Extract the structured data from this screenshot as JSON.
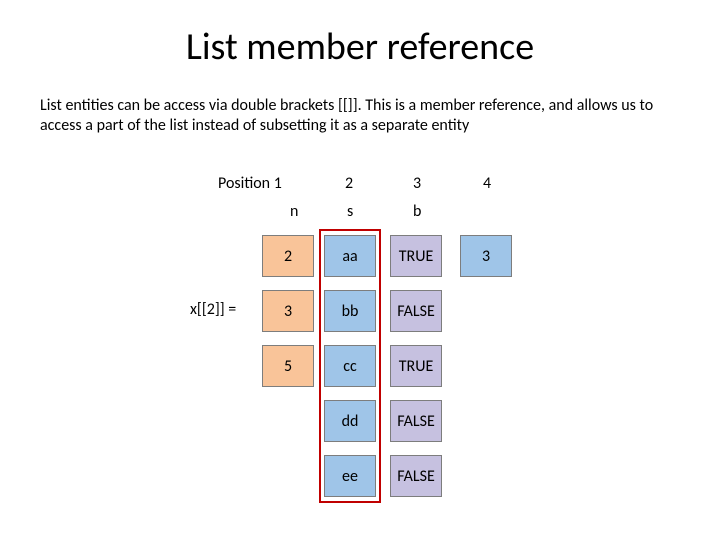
{
  "title": "List member reference",
  "description": "List entities can be access via double brackets [[]]. This is a member reference, and allows us to access a part of the list instead of subsetting it as a separate entity",
  "positions": {
    "p1": "Position 1",
    "p2": "2",
    "p3": "3",
    "p4": "4"
  },
  "headers": {
    "n": "n",
    "s": "s",
    "b": "b"
  },
  "expr": "x[[2]] =",
  "col_n": {
    "r1": "2",
    "r2": "3",
    "r3": "5"
  },
  "col_s": {
    "r1": "aa",
    "r2": "bb",
    "r3": "cc",
    "r4": "dd",
    "r5": "ee"
  },
  "col_b": {
    "r1": "TRUE",
    "r2": "FALSE",
    "r3": "TRUE",
    "r4": "FALSE",
    "r5": "FALSE"
  },
  "col_4": {
    "r1": "3"
  }
}
